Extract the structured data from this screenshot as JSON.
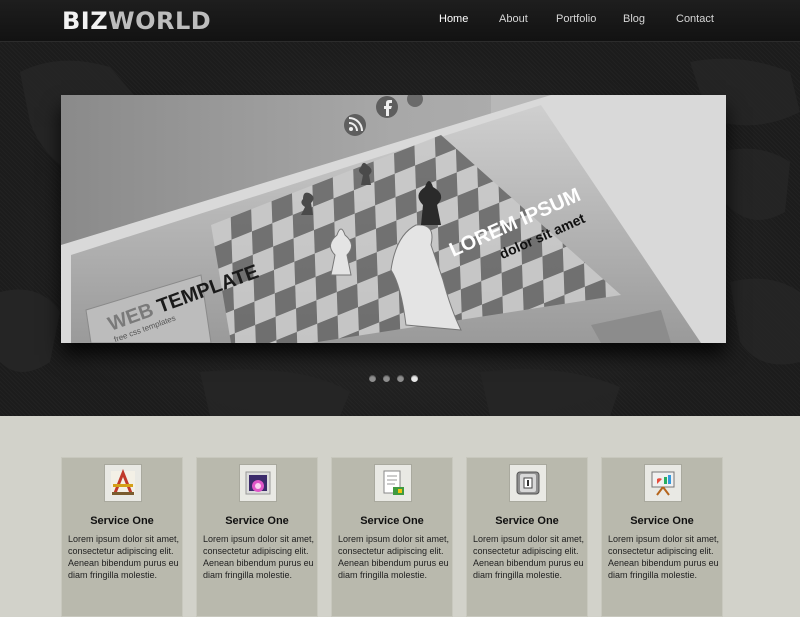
{
  "brand": {
    "part1": "BIZ",
    "part2": "WORLD"
  },
  "nav": [
    {
      "label": "Home",
      "active": true
    },
    {
      "label": "About",
      "active": false
    },
    {
      "label": "Portfolio",
      "active": false
    },
    {
      "label": "Blog",
      "active": false
    },
    {
      "label": "Contact",
      "active": false
    }
  ],
  "slider": {
    "headline": "LOREM IPSUM",
    "subheadline": "dolor sit amet",
    "template_title_web": "WEB",
    "template_title_rest": " TEMPLATE",
    "template_tagline": "free css templates",
    "social_icons": [
      "rss-icon",
      "facebook-icon",
      "gear-icon"
    ],
    "dots": 4,
    "active_dot": 4
  },
  "services": [
    {
      "icon": "drafting-tools-icon",
      "title": "Service One",
      "text": "Lorem ipsum dolor sit amet, consectetur adipiscing elit. Aenean bibendum purus eu diam fringilla molestie."
    },
    {
      "icon": "photo-icon",
      "title": "Service One",
      "text": "Lorem ipsum dolor sit amet, consectetur adipiscing elit. Aenean bibendum purus eu diam fringilla molestie."
    },
    {
      "icon": "document-icon",
      "title": "Service One",
      "text": "Lorem ipsum dolor sit amet, consectetur adipiscing elit. Aenean bibendum purus eu diam fringilla molestie."
    },
    {
      "icon": "disk-icon",
      "title": "Service One",
      "text": "Lorem ipsum dolor sit amet, consectetur adipiscing elit. Aenean bibendum purus eu diam fringilla molestie."
    },
    {
      "icon": "presentation-board-icon",
      "title": "Service One",
      "text": "Lorem ipsum dolor sit amet, consectetur adipiscing elit. Aenean bibendum purus eu diam fringilla molestie."
    }
  ],
  "colors": {
    "header_bg": "#161616",
    "hero_bg": "#1c1c1c",
    "services_bg": "#d2d2ca",
    "card_bg": "#b9b9ad"
  }
}
